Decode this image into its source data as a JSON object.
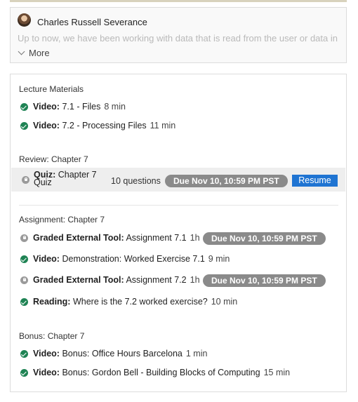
{
  "header": {
    "author": "Charles Russell Severance",
    "description": "Up to now, we have been working with data that is read from the user or data in",
    "more_label": "More"
  },
  "sections": {
    "lecture": {
      "title": "Lecture Materials",
      "items": [
        {
          "type": "Video:",
          "title": "7.1 - Files",
          "duration": "8 min"
        },
        {
          "type": "Video:",
          "title": "7.2 - Processing Files",
          "duration": "11 min"
        }
      ]
    },
    "review": {
      "title": "Review: Chapter 7",
      "quiz": {
        "type": "Quiz:",
        "title": "Chapter 7",
        "title2": "Quiz",
        "questions": "10 questions",
        "due": "Due Nov 10, 10:59 PM PST",
        "action": "Resume"
      }
    },
    "assignment": {
      "title": "Assignment: Chapter 7",
      "items": [
        {
          "type": "Graded External Tool:",
          "title": "Assignment 7.1",
          "duration": "1h",
          "due": "Due Nov 10, 10:59 PM PST"
        },
        {
          "type": "Video:",
          "title": "Demonstration: Worked Exercise 7.1",
          "duration": "9 min"
        },
        {
          "type": "Graded External Tool:",
          "title": "Assignment 7.2",
          "duration": "1h",
          "due": "Due Nov 10, 10:59 PM PST"
        },
        {
          "type": "Reading:",
          "title": "Where is the 7.2 worked exercise?",
          "duration": "10 min"
        }
      ]
    },
    "bonus": {
      "title": "Bonus: Chapter 7",
      "items": [
        {
          "type": "Video:",
          "title": "Bonus: Office Hours Barcelona",
          "duration": "1 min"
        },
        {
          "type": "Video:",
          "title": "Bonus: Gordon Bell - Building Blocks of Computing",
          "duration": "15 min"
        }
      ]
    }
  },
  "colors": {
    "complete": "#1f8354",
    "locked": "#9a9a9a",
    "due_badge": "#8a8a8a",
    "resume_button": "#1f74d2"
  }
}
